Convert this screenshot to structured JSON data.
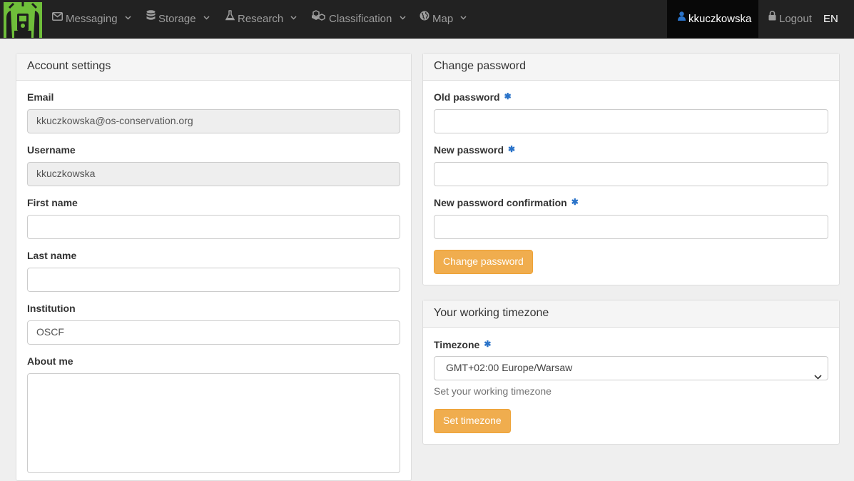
{
  "navbar": {
    "logo_icon": "trapper-logo-icon",
    "menus": [
      {
        "label": "Messaging",
        "icon": "envelope-icon"
      },
      {
        "label": "Storage",
        "icon": "database-icon"
      },
      {
        "label": "Research",
        "icon": "flask-icon"
      },
      {
        "label": "Classification",
        "icon": "cubes-icon"
      },
      {
        "label": "Map",
        "icon": "globe-icon"
      }
    ],
    "user": "kkuczkowska",
    "logout": "Logout",
    "language": "EN"
  },
  "account": {
    "title": "Account settings",
    "email_label": "Email",
    "email_value": "kkuczkowska@os-conservation.org",
    "username_label": "Username",
    "username_value": "kkuczkowska",
    "first_name_label": "First name",
    "first_name_value": "",
    "last_name_label": "Last name",
    "last_name_value": "",
    "institution_label": "Institution",
    "institution_value": "OSCF",
    "about_label": "About me",
    "about_value": ""
  },
  "password": {
    "title": "Change password",
    "old_label": "Old password",
    "new_label": "New password",
    "confirm_label": "New password confirmation",
    "required_mark": "✱",
    "button": "Change password"
  },
  "timezone": {
    "title": "Your working timezone",
    "label": "Timezone",
    "selected": "GMT+02:00 Europe/Warsaw",
    "help": "Set your working timezone",
    "button": "Set timezone"
  },
  "colors": {
    "navbar_bg": "#222222",
    "accent_warning": "#f0ad4e",
    "required_mark": "#2a73c9",
    "logo_green": "#5cb85c"
  }
}
